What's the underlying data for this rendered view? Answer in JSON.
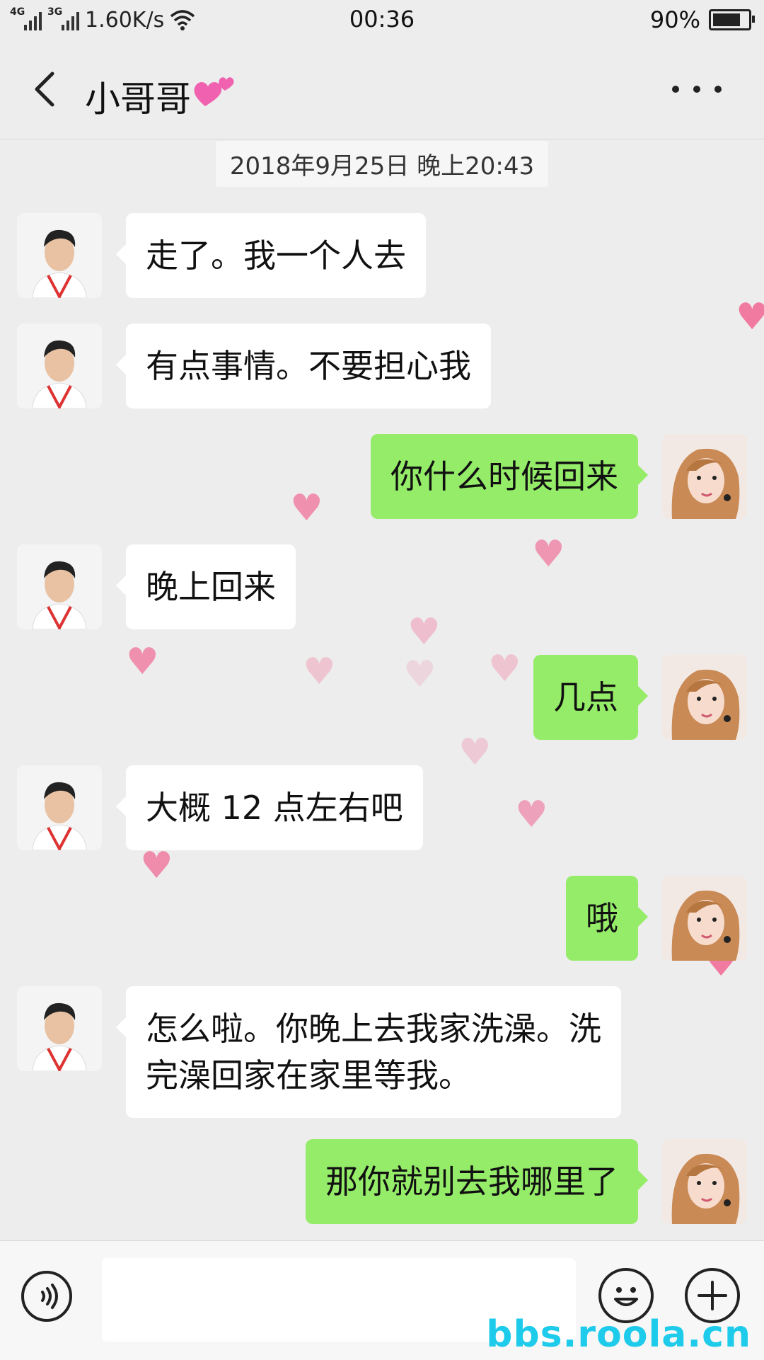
{
  "status_bar": {
    "network_1": "4G",
    "network_2": "3G",
    "speed": "1.60K/s",
    "time": "00:36",
    "battery": "90%",
    "battery_level": 0.9
  },
  "header": {
    "title": "小哥哥"
  },
  "chat": {
    "timestamp": "2018年9月25日 晚上20:43",
    "messages": [
      {
        "side": "left",
        "text": "走了。我一个人去"
      },
      {
        "side": "left",
        "text": "有点事情。不要担心我"
      },
      {
        "side": "right",
        "text": "你什么时候回来"
      },
      {
        "side": "left",
        "text": "晚上回来"
      },
      {
        "side": "right",
        "text": "几点"
      },
      {
        "side": "left",
        "text": "大概 12 点左右吧"
      },
      {
        "side": "right",
        "text": "哦"
      },
      {
        "side": "left",
        "text": "怎么啦。你晚上去我家洗澡。洗\n完澡回家在家里等我。"
      },
      {
        "side": "right",
        "text": "那你就别去我哪里了"
      }
    ]
  },
  "watermark": "bbs.roola.cn",
  "colors": {
    "background": "#ededed",
    "sent_bubble": "#95ec69",
    "received_bubble": "#ffffff",
    "heart": "#f07aa0",
    "watermark": "#1ecbea"
  },
  "icons": {
    "back": "chevron-left-icon",
    "more": "more-dots-icon",
    "voice": "voice-icon",
    "emoji": "emoji-icon",
    "plus": "plus-icon",
    "title_decoration": "pink-hearts-emoji"
  }
}
